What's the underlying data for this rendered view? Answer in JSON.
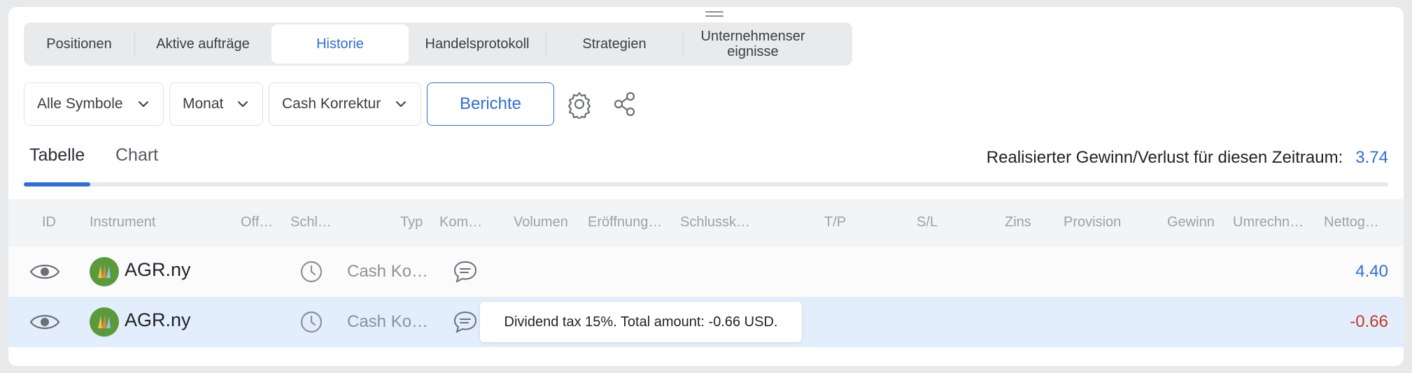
{
  "tabs": [
    {
      "label": "Positionen"
    },
    {
      "label": "Aktive aufträge"
    },
    {
      "label": "Historie"
    },
    {
      "label": "Handelsprotokoll"
    },
    {
      "label": "Strategien"
    },
    {
      "label": "Unternehmenser eignisse",
      "line1": "Unternehmenser",
      "line2": "eignisse"
    }
  ],
  "active_tab": "Historie",
  "filters": {
    "symbols": "Alle Symbole",
    "period": "Monat",
    "type": "Cash Korrektur",
    "reports_button": "Berichte"
  },
  "view_tabs": {
    "table": "Tabelle",
    "chart": "Chart",
    "active": "Tabelle"
  },
  "summary": {
    "label": "Realisierter Gewinn/Verlust für diesen Zeitraum:",
    "value": "3.74"
  },
  "columns": [
    "ID",
    "Instrument",
    "Off…",
    "Schl…",
    "Typ",
    "Kom…",
    "Volumen",
    "Eröffnung…",
    "Schlussk…",
    "T/P",
    "S/L",
    "Zins",
    "Provision",
    "Gewinn",
    "Umrechn…",
    "Nettog…"
  ],
  "rows": [
    {
      "symbol": "AGR.ny",
      "type": "Cash Ko…",
      "net": "4.40",
      "selected": false
    },
    {
      "symbol": "AGR.ny",
      "type": "Cash Ko…",
      "net": "-0.66",
      "selected": true
    }
  ],
  "tooltip": "Dividend tax 15%. Total amount: -0.66 USD.",
  "colors": {
    "accent": "#2f6fd6",
    "negative": "#c0392b",
    "selected_row": "#e3eefc",
    "logo_green": "#5a9a3b"
  },
  "icons": [
    "drag-handle-icon",
    "chevron-down-icon",
    "gear-icon",
    "share-icon",
    "eye-icon",
    "clock-icon",
    "comment-icon",
    "instrument-logo"
  ]
}
